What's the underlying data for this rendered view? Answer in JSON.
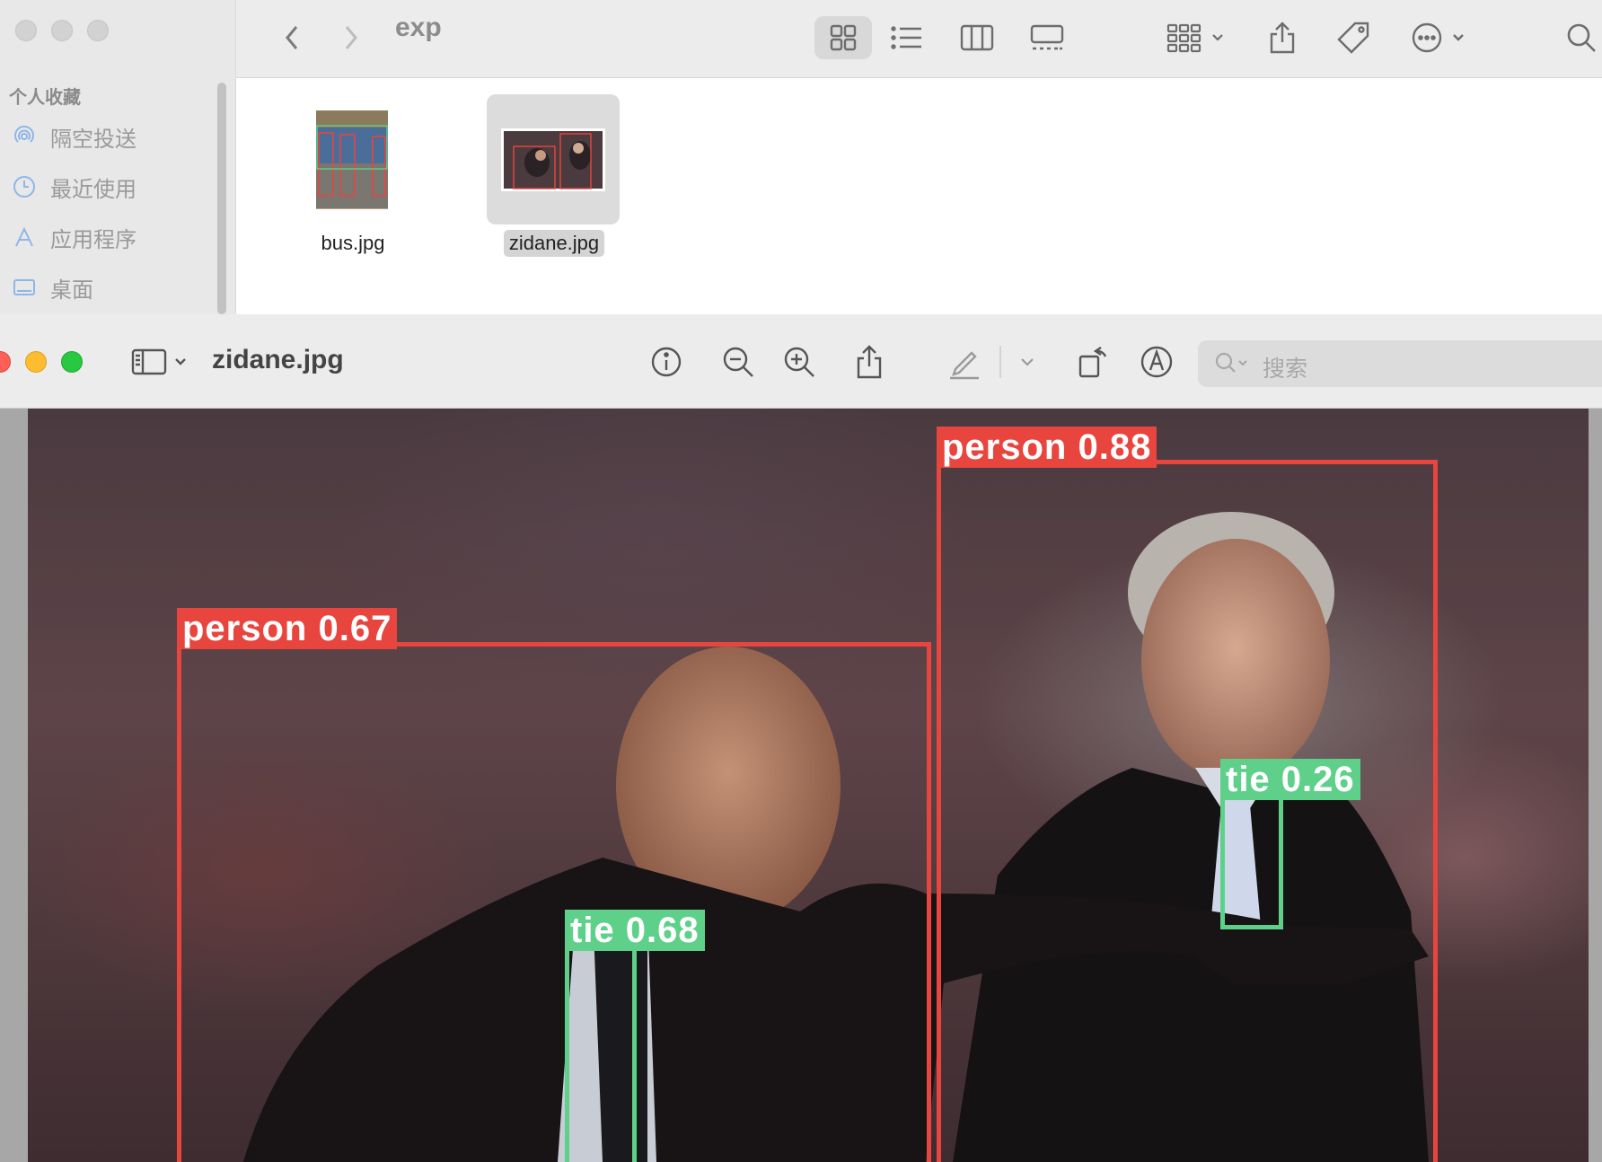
{
  "finder": {
    "title": "exp",
    "sidebar": {
      "section": "个人收藏",
      "items": [
        {
          "label": "隔空投送",
          "icon": "airdrop-icon"
        },
        {
          "label": "最近使用",
          "icon": "clock-icon"
        },
        {
          "label": "应用程序",
          "icon": "applications-icon"
        },
        {
          "label": "桌面",
          "icon": "desktop-icon"
        }
      ]
    },
    "files": [
      {
        "name": "bus.jpg",
        "selected": false
      },
      {
        "name": "zidane.jpg",
        "selected": true
      }
    ]
  },
  "preview": {
    "title": "zidane.jpg",
    "search_placeholder": "搜索",
    "detections": [
      {
        "label": "person 0.88",
        "class": "person"
      },
      {
        "label": "person 0.67",
        "class": "person"
      },
      {
        "label": "tie 0.26",
        "class": "tie"
      },
      {
        "label": "tie 0.68",
        "class": "tie"
      }
    ]
  },
  "colors": {
    "person_box": "#e8453f",
    "tie_box": "#5fd08a",
    "traffic_close": "#ff5f57",
    "traffic_minimize": "#febc2e",
    "traffic_zoom": "#28c840"
  }
}
